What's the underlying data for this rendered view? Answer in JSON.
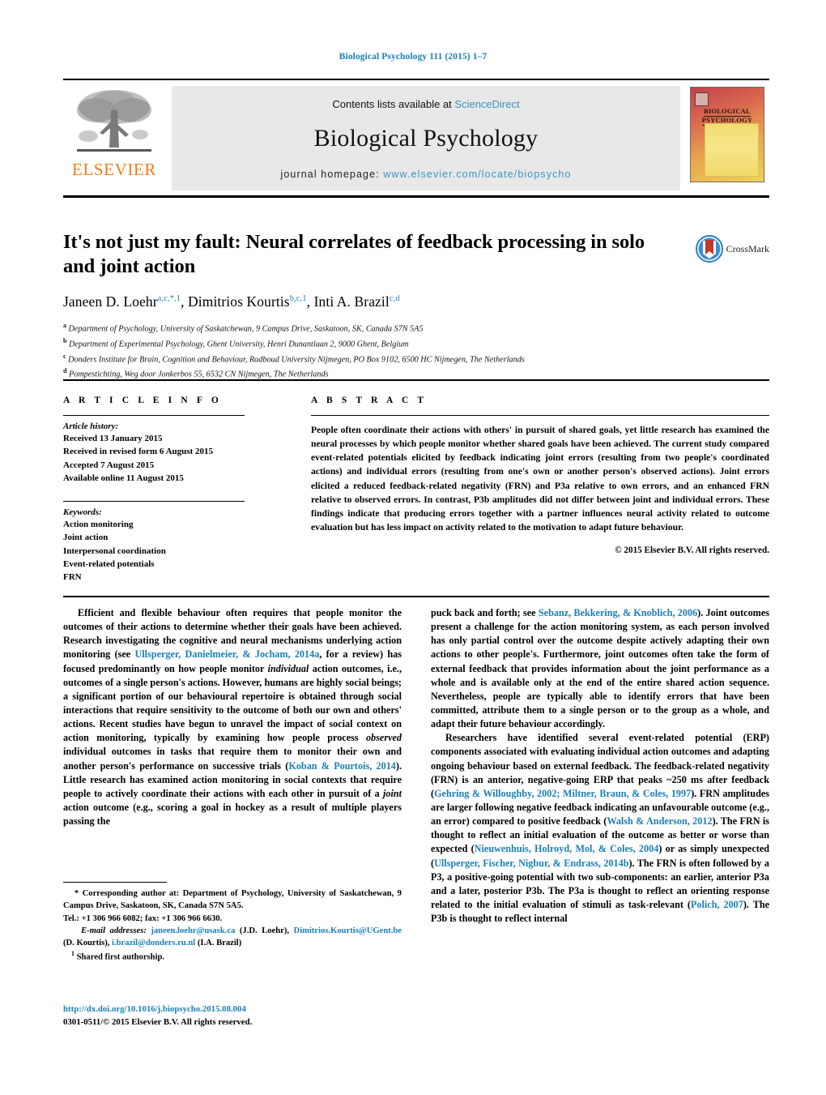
{
  "running_head": "Biological Psychology 111 (2015) 1–7",
  "masthead": {
    "publisher_name": "ELSEVIER",
    "contents_prefix": "Contents lists available at ",
    "sciencedirect_link": "ScienceDirect",
    "journal_title": "Biological Psychology",
    "homepage_prefix": "journal homepage: ",
    "homepage_url": "www.elsevier.com/locate/biopsycho",
    "cover_title_line1": "BIOLOGICAL",
    "cover_title_line2": "PSYCHOLOGY",
    "accent_orange": "#f07d1a",
    "link_blue": "#3a93c9",
    "band_grey": "#e8e8e8"
  },
  "article": {
    "title": "It's not just my fault: Neural correlates of feedback processing in solo and joint action",
    "crossmark_label": "CrossMark",
    "authors_html": "Janeen D. Loehr<sup>a,c,</sup><sup>*</sup><sup>,1</sup>, Dimitrios Kourtis<sup>b,c,1</sup>, Inti A. Brazil<sup>c,d</sup>",
    "affiliations": [
      {
        "mark": "a",
        "text": "Department of Psychology, University of Saskatchewan, 9 Campus Drive, Saskatoon, SK, Canada S7N 5A5"
      },
      {
        "mark": "b",
        "text": "Department of Experimental Psychology, Ghent University, Henri Dunantlaan 2, 9000 Ghent, Belgium"
      },
      {
        "mark": "c",
        "text": "Donders Institute for Brain, Cognition and Behaviour, Radboud University Nijmegen, PO Box 9102, 6500 HC Nijmegen, The Netherlands"
      },
      {
        "mark": "d",
        "text": "Pompestichting, Weg door Jonkerbos 55, 6532 CN Nijmegen, The Netherlands"
      }
    ]
  },
  "article_info": {
    "heading": "A R T I C L E   I N F O",
    "history_label": "Article history:",
    "history": [
      "Received 13 January 2015",
      "Received in revised form 6 August 2015",
      "Accepted 7 August 2015",
      "Available online 11 August 2015"
    ],
    "keywords_label": "Keywords:",
    "keywords": [
      "Action monitoring",
      "Joint action",
      "Interpersonal coordination",
      "Event-related potentials",
      "FRN"
    ]
  },
  "abstract": {
    "heading": "A B S T R A C T",
    "text": "People often coordinate their actions with others' in pursuit of shared goals, yet little research has examined the neural processes by which people monitor whether shared goals have been achieved. The current study compared event-related potentials elicited by feedback indicating joint errors (resulting from two people's coordinated actions) and individual errors (resulting from one's own or another person's observed actions). Joint errors elicited a reduced feedback-related negativity (FRN) and P3a relative to own errors, and an enhanced FRN relative to observed errors. In contrast, P3b amplitudes did not differ between joint and individual errors. These findings indicate that producing errors together with a partner influences neural activity related to outcome evaluation but has less impact on activity related to the motivation to adapt future behaviour.",
    "copyright": "© 2015 Elsevier B.V. All rights reserved."
  },
  "body": {
    "left": [
      {
        "segments": [
          {
            "t": "Efficient and flexible behaviour often requires that people monitor the outcomes of their actions to determine whether their goals have been achieved. Research investigating the cognitive and neural mechanisms underlying action monitoring (see ",
            "s": "plain"
          },
          {
            "t": "Ullsperger, Danielmeier, & Jocham, 2014a",
            "s": "ref"
          },
          {
            "t": ", for a review) has focused predominantly on how people monitor ",
            "s": "plain"
          },
          {
            "t": "individual",
            "s": "italic"
          },
          {
            "t": " action outcomes, i.e., outcomes of a single person's actions. However, humans are highly social beings; a significant portion of our behavioural repertoire is obtained through social interactions that require sensitivity to the outcome of both our own and others' actions. Recent studies have begun to unravel the impact of social context on action monitoring, typically by examining how people process ",
            "s": "plain"
          },
          {
            "t": "observed",
            "s": "italic"
          },
          {
            "t": " individual outcomes in tasks that require them to monitor their own and another person's performance on successive trials (",
            "s": "plain"
          },
          {
            "t": "Koban & Pourtois, 2014",
            "s": "ref"
          },
          {
            "t": "). Little research has examined action monitoring in social contexts that require people to actively coordinate their actions with each other in pursuit of a ",
            "s": "plain"
          },
          {
            "t": "joint",
            "s": "italic"
          },
          {
            "t": " action outcome (e.g., scoring a goal in hockey as a result of multiple players passing the",
            "s": "plain"
          }
        ],
        "indent": true
      }
    ],
    "right": [
      {
        "segments": [
          {
            "t": "puck back and forth; see ",
            "s": "plain"
          },
          {
            "t": "Sebanz, Bekkering, & Knoblich, 2006",
            "s": "ref"
          },
          {
            "t": "). Joint outcomes present a challenge for the action monitoring system, as each person involved has only partial control over the outcome despite actively adapting their own actions to other people's. Furthermore, joint outcomes often take the form of external feedback that provides information about the joint performance as a whole and is available only at the end of the entire shared action sequence. Nevertheless, people are typically able to identify errors that have been committed, attribute them to a single person or to the group as a whole, and adapt their future behaviour accordingly.",
            "s": "plain"
          }
        ],
        "indent": false
      },
      {
        "segments": [
          {
            "t": "Researchers have identified several event-related potential (ERP) components associated with evaluating individual action outcomes and adapting ongoing behaviour based on external feedback. The feedback-related negativity (FRN) is an anterior, negative-going ERP that peaks ~250 ms after feedback (",
            "s": "plain"
          },
          {
            "t": "Gehring & Willoughby, 2002; Miltner, Braun, & Coles, 1997",
            "s": "ref"
          },
          {
            "t": "). FRN amplitudes are larger following negative feedback indicating an unfavourable outcome (e.g., an error) compared to positive feedback (",
            "s": "plain"
          },
          {
            "t": "Walsh & Anderson, 2012",
            "s": "ref"
          },
          {
            "t": "). The FRN is thought to reflect an initial evaluation of the outcome as better or worse than expected (",
            "s": "plain"
          },
          {
            "t": "Nieuwenhuis, Holroyd, Mol, & Coles, 2004",
            "s": "ref"
          },
          {
            "t": ") or as simply unexpected (",
            "s": "plain"
          },
          {
            "t": "Ullsperger, Fischer, Nigbur, & Endrass, 2014b",
            "s": "ref"
          },
          {
            "t": "). The FRN is often followed by a P3, a positive-going potential with two sub-components: an earlier, anterior P3a and a later, posterior P3b. The P3a is thought to reflect an orienting response related to the initial evaluation of stimuli as task-relevant (",
            "s": "plain"
          },
          {
            "t": "Polich, 2007",
            "s": "ref"
          },
          {
            "t": "). The P3b is thought to reflect internal",
            "s": "plain"
          }
        ],
        "indent": true
      }
    ]
  },
  "footnotes": {
    "corresponding": {
      "star": "*",
      "text": "Corresponding author at: Department of Psychology, University of Saskatchewan, 9 Campus Drive, Saskatoon, SK, Canada S7N 5A5."
    },
    "tel_line": "Tel.: +1 306 966 6082; fax: +1 306 966 6630.",
    "email_label": "E-mail addresses:",
    "emails": [
      {
        "address": "janeen.loehr@usask.ca",
        "owner": "(J.D. Loehr)"
      },
      {
        "address": "Dimitrios.Kourtis@UGent.be",
        "owner": "(D. Kourtis)"
      },
      {
        "address": "i.brazil@donders.ru.nl",
        "owner": "(I.A. Brazil)"
      }
    ],
    "shared_mark": "1",
    "shared_text": "Shared first authorship."
  },
  "doi": {
    "url": "http://dx.doi.org/10.1016/j.biopsycho.2015.08.004",
    "issn_line": "0301-0511/© 2015 Elsevier B.V. All rights reserved."
  }
}
